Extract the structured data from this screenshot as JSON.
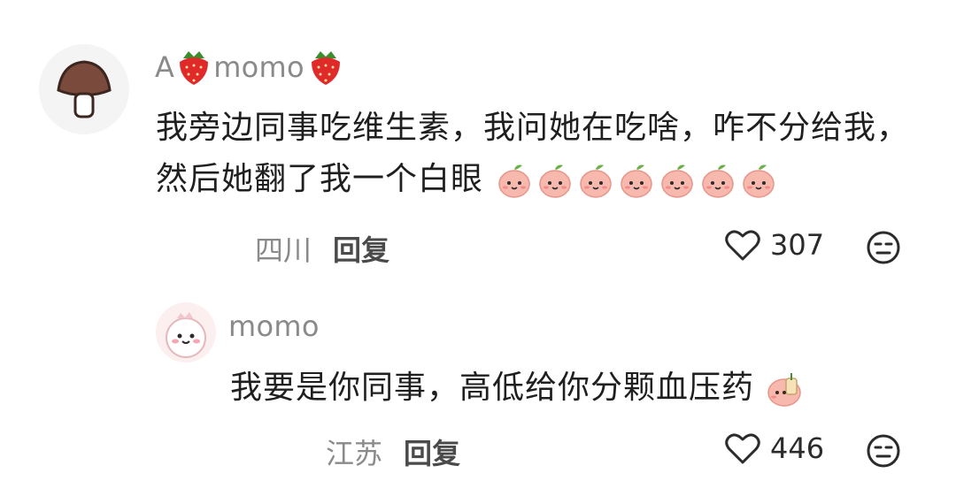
{
  "comments": [
    {
      "username_prefix": "A",
      "username_main": "momo",
      "content": "我旁边同事吃维生素，我问她在吃啥，咋不分给我，然后她翻了我一个白眼",
      "emoji_count": 7,
      "region": "四川",
      "reply_label": "回复",
      "likes": "307",
      "icons": [
        "mushroom-avatar-icon",
        "strawberry-icon",
        "peach-face-emoji",
        "heart-icon",
        "dislike-face-icon"
      ]
    },
    {
      "username": "momo",
      "content": "我要是你同事，高低给你分颗血压药",
      "region": "江苏",
      "reply_label": "回复",
      "likes": "446",
      "icons": [
        "cartoon-avatar-icon",
        "peach-tea-emoji",
        "heart-icon",
        "dislike-face-icon"
      ]
    }
  ],
  "colors": {
    "text_primary": "#1f1f1f",
    "text_secondary": "#8a8a8a",
    "peach": "#f7b8ad"
  }
}
